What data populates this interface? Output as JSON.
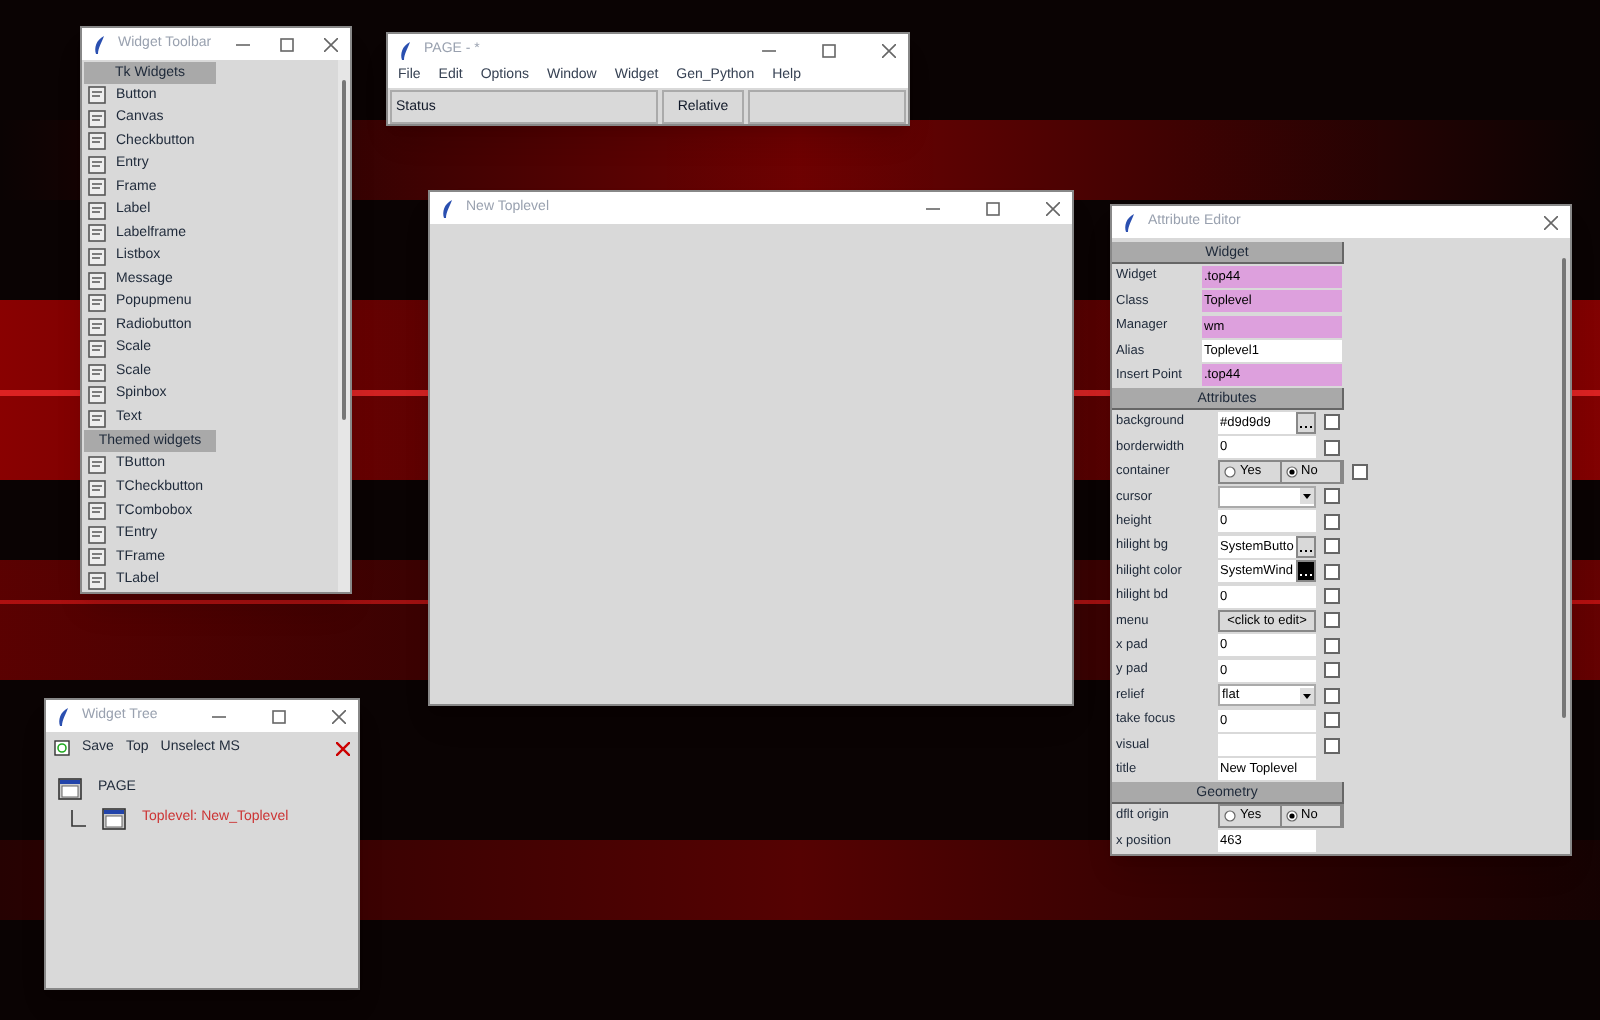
{
  "widget_toolbar": {
    "title": "Widget Toolbar",
    "sections": [
      {
        "header": "Tk Widgets",
        "items": [
          {
            "label": "Button"
          },
          {
            "label": "Canvas"
          },
          {
            "label": "Checkbutton"
          },
          {
            "label": "Entry"
          },
          {
            "label": "Frame"
          },
          {
            "label": "Label"
          },
          {
            "label": "Labelframe"
          },
          {
            "label": "Listbox"
          },
          {
            "label": "Message"
          },
          {
            "label": "Popupmenu"
          },
          {
            "label": "Radiobutton"
          },
          {
            "label": "Scale"
          },
          {
            "label": "Scale"
          },
          {
            "label": "Spinbox"
          },
          {
            "label": "Text"
          }
        ]
      },
      {
        "header": "Themed widgets",
        "items": [
          {
            "label": "TButton"
          },
          {
            "label": "TCheckbutton"
          },
          {
            "label": "TCombobox"
          },
          {
            "label": "TEntry"
          },
          {
            "label": "TFrame"
          },
          {
            "label": "TLabel"
          }
        ]
      }
    ]
  },
  "page_window": {
    "title": "PAGE - *",
    "menu": [
      "File",
      "Edit",
      "Options",
      "Window",
      "Widget",
      "Gen_Python",
      "Help"
    ],
    "status_bar": [
      "Status",
      "Relative"
    ]
  },
  "toplevel_window": {
    "title": "New Toplevel"
  },
  "attribute_editor": {
    "title": "Attribute Editor",
    "sections": [
      {
        "header": "Widget",
        "rows": [
          {
            "label": "Widget",
            "kind": "text",
            "value": ".top44",
            "readonly": true
          },
          {
            "label": "Class",
            "kind": "text",
            "value": "Toplevel",
            "readonly": true
          },
          {
            "label": "Manager",
            "kind": "text",
            "value": "wm",
            "readonly": true
          },
          {
            "label": "Alias",
            "kind": "text",
            "value": "Toplevel1",
            "readonly": false
          },
          {
            "label": "Insert Point",
            "kind": "text",
            "value": ".top44",
            "readonly": true
          }
        ]
      },
      {
        "header": "Attributes",
        "rows": [
          {
            "label": "background",
            "kind": "color",
            "value": "#d9d9d9",
            "dark_swatch": false,
            "checked": false
          },
          {
            "label": "borderwidth",
            "kind": "entry",
            "value": "0",
            "checked": false
          },
          {
            "label": "container",
            "kind": "radio",
            "options": [
              {
                "label": "Yes",
                "selected": false
              },
              {
                "label": "No",
                "selected": true
              }
            ],
            "checked": false
          },
          {
            "label": "cursor",
            "kind": "combo",
            "value": "",
            "checked": false
          },
          {
            "label": "height",
            "kind": "entry",
            "value": "0",
            "checked": false
          },
          {
            "label": "hilight bg",
            "kind": "color",
            "value": "SystemButto",
            "dark_swatch": false,
            "checked": false
          },
          {
            "label": "hilight color",
            "kind": "color",
            "value": "SystemWind",
            "dark_swatch": true,
            "checked": false
          },
          {
            "label": "hilight bd",
            "kind": "entry",
            "value": "0",
            "checked": false
          },
          {
            "label": "menu",
            "kind": "click",
            "value": "<click to edit>",
            "checked": false
          },
          {
            "label": "x pad",
            "kind": "entry",
            "value": "0",
            "checked": false
          },
          {
            "label": "y pad",
            "kind": "entry",
            "value": "0",
            "checked": false
          },
          {
            "label": "relief",
            "kind": "combo",
            "value": "flat",
            "checked": false
          },
          {
            "label": "take focus",
            "kind": "entry",
            "value": "0",
            "checked": false
          },
          {
            "label": "visual",
            "kind": "entry",
            "value": "",
            "checked": false
          },
          {
            "label": "title",
            "kind": "entry",
            "value": "New Toplevel"
          }
        ]
      },
      {
        "header": "Geometry",
        "rows": [
          {
            "label": "dflt origin",
            "kind": "radio",
            "options": [
              {
                "label": "Yes",
                "selected": false
              },
              {
                "label": "No",
                "selected": true
              }
            ]
          },
          {
            "label": "x position",
            "kind": "entry",
            "value": "463"
          }
        ]
      }
    ]
  },
  "widget_tree": {
    "title": "Widget Tree",
    "toolbar": [
      "Save",
      "Top",
      "Unselect MS"
    ],
    "tree": [
      {
        "label": "PAGE",
        "selected": false,
        "children": [
          {
            "label": "Toplevel: New_Toplevel",
            "selected": true
          }
        ]
      }
    ]
  }
}
